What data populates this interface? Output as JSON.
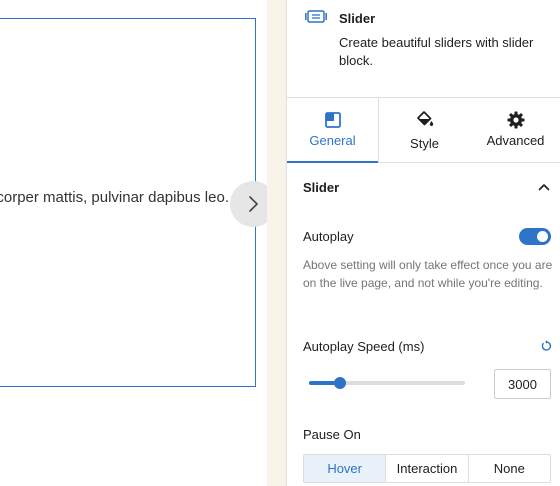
{
  "canvas": {
    "slide_text": "Lorem ipsum dolor sit amet, ullamcorper mattis, pulvinar dapibus leo."
  },
  "block": {
    "icon": "slider-icon",
    "title": "Slider",
    "description": "Create beautiful sliders with slider block."
  },
  "tabs": [
    {
      "label": "General",
      "icon": "general-icon",
      "active": true
    },
    {
      "label": "Style",
      "icon": "paint-bucket-icon",
      "active": false
    },
    {
      "label": "Advanced",
      "icon": "gear-icon",
      "active": false
    }
  ],
  "section": {
    "title": "Slider"
  },
  "autoplay": {
    "label": "Autoplay",
    "enabled": true,
    "help": "Above setting will only take effect once you are on the live page, and not while you're editing."
  },
  "autoplay_speed": {
    "label": "Autoplay Speed (ms)",
    "value": "3000",
    "slider_fraction": 0.2
  },
  "pause_on": {
    "label": "Pause On",
    "options": [
      "Hover",
      "Interaction",
      "None"
    ],
    "selected": "Hover"
  },
  "colors": {
    "accent": "#2d74c9",
    "gutter": "#f8f4ea"
  }
}
